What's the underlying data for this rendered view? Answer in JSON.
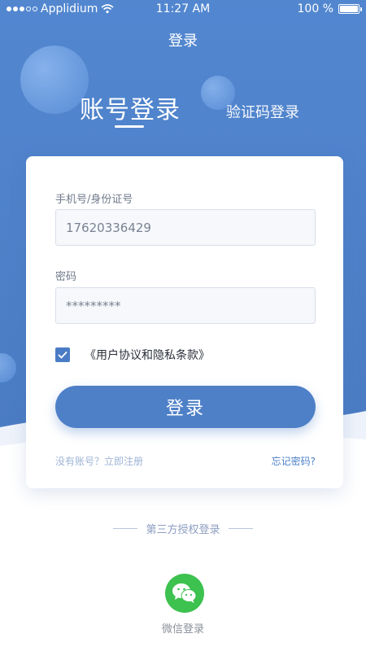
{
  "status_bar": {
    "carrier": "Applidium",
    "time": "11:27 AM",
    "battery": "100 %",
    "battery_level": 1.0
  },
  "header": {
    "title": "登录"
  },
  "tabs": {
    "account": "账号登录",
    "code": "验证码登录"
  },
  "form": {
    "account_label": "手机号/身份证号",
    "account_value": "17620336429",
    "password_label": "密码",
    "password_value": "*********",
    "agree_text": "《用户协议和隐私条款》",
    "agree_checked": true,
    "login_button": "登录",
    "register_link": "没有账号？立即注册",
    "forgot_link": "忘记密码?"
  },
  "third_party": {
    "title": "第三方授权登录",
    "wechat_label": "微信登录"
  },
  "colors": {
    "primary": "#4e80c8",
    "hero_bg": "#4d7ec6",
    "wechat": "#3dc14f"
  },
  "icons": [
    "wifi-icon",
    "battery-icon",
    "check-icon",
    "wechat-icon"
  ]
}
